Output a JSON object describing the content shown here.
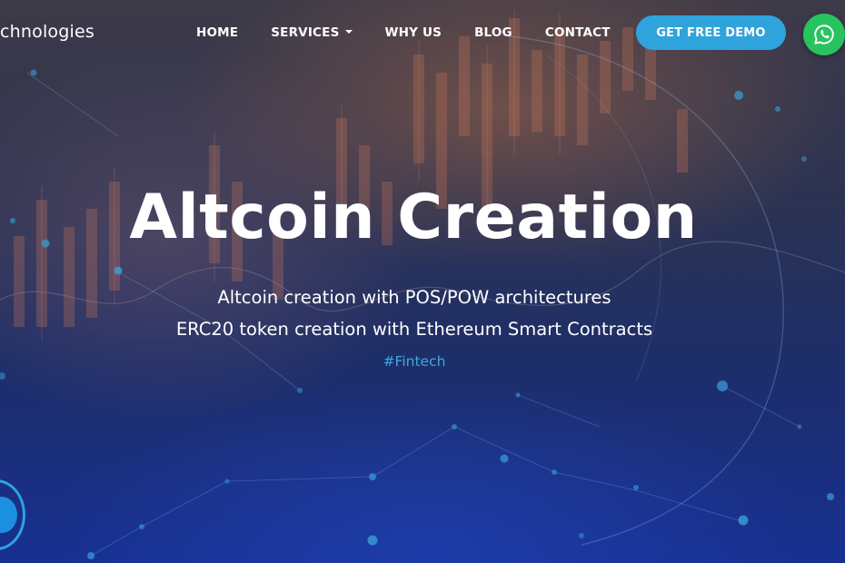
{
  "brand": {
    "text": "chnologies"
  },
  "nav": {
    "items": [
      {
        "label": "HOME"
      },
      {
        "label": "SERVICES"
      },
      {
        "label": "WHY US"
      },
      {
        "label": "BLOG"
      },
      {
        "label": "CONTACT"
      }
    ],
    "cta_label": "GET FREE DEMO"
  },
  "hero": {
    "title": "Altcoin Creation",
    "line1": "Altcoin creation with POS/POW architectures",
    "line2": "ERC20 token creation with Ethereum Smart Contracts",
    "hashtag": "#Fintech"
  },
  "icons": {
    "whatsapp": "whatsapp-icon",
    "dropdown": "chevron-down-icon",
    "badge": "chat-widget-icon"
  },
  "colors": {
    "accent": "#2fa3dc",
    "whatsapp": "#28c35f",
    "hashtag": "#3fa8e0",
    "text": "#ffffff"
  }
}
